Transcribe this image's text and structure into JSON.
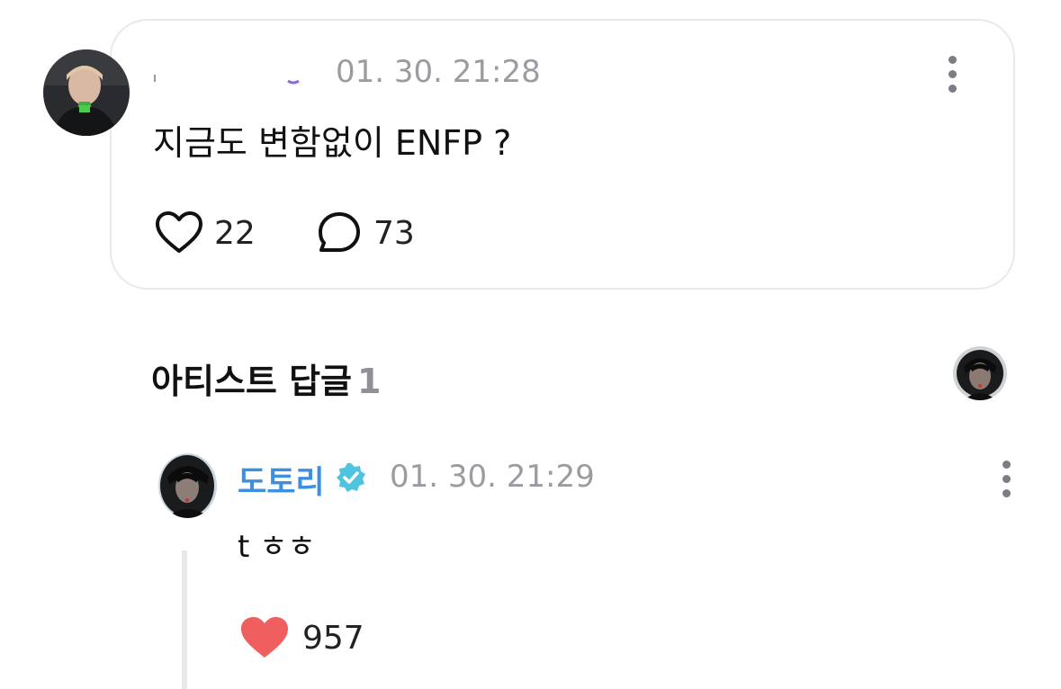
{
  "post": {
    "timestamp": "01. 30. 21:28",
    "text": "지금도 변함없이 ENFP ?",
    "like_count": "22",
    "reply_count": "73"
  },
  "artist_replies": {
    "title": "아티스트 답글",
    "count": "1"
  },
  "reply": {
    "author": "도토리",
    "timestamp": "01. 30. 21:29",
    "text": "t ㅎㅎ",
    "like_count": "957"
  },
  "icons": {
    "like": "heart-outline-icon",
    "reply": "speech-bubble-icon",
    "more": "vertical-dots-icon",
    "verified": "verified-badge-icon",
    "liked": "heart-filled-icon"
  },
  "colors": {
    "author_name": "#3d8fe0",
    "verified_badge": "#4fc3e0",
    "liked_heart": "#ef5f5f",
    "timestamp": "#9a9ca2"
  }
}
